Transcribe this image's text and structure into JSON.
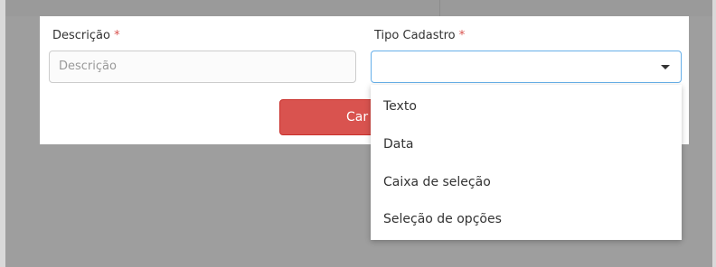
{
  "form": {
    "descricao_label": "Descrição",
    "descricao_required": "*",
    "descricao_placeholder": "Descrição",
    "tipo_label": "Tipo Cadastro",
    "tipo_required": "*",
    "tipo_value": ""
  },
  "button": {
    "label": "Car"
  },
  "dropdown": {
    "options": [
      {
        "label": "Texto"
      },
      {
        "label": "Data"
      },
      {
        "label": "Caixa de seleção"
      },
      {
        "label": "Seleção de opções"
      }
    ]
  },
  "colors": {
    "required": "#d9534f",
    "button_bg": "#d9534f",
    "select_border": "#66afe9",
    "overlay": "#9e9e9e"
  },
  "icons": {
    "select_caret": "caret-down-icon"
  }
}
